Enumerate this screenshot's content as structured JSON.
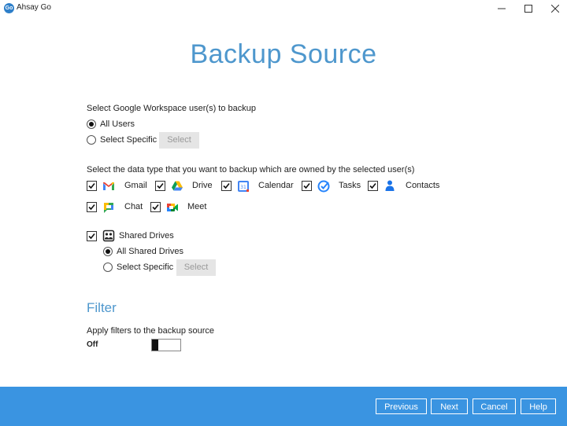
{
  "window": {
    "logo_text": "Go",
    "title": "Ahsay Go"
  },
  "page": {
    "title": "Backup Source"
  },
  "users": {
    "prompt": "Select Google Workspace user(s) to backup",
    "all_users_label": "All Users",
    "all_users_selected": true,
    "select_specific_label": "Select Specific",
    "select_specific_selected": false,
    "select_button": "Select"
  },
  "data_types": {
    "prompt": "Select the data type that you want to backup which are owned by the selected user(s)",
    "items": [
      {
        "label": "Gmail",
        "icon": "gmail-icon",
        "checked": true
      },
      {
        "label": "Drive",
        "icon": "google-drive-icon",
        "checked": true
      },
      {
        "label": "Calendar",
        "icon": "google-calendar-icon",
        "checked": true
      },
      {
        "label": "Tasks",
        "icon": "google-tasks-icon",
        "checked": true
      },
      {
        "label": "Contacts",
        "icon": "google-contacts-icon",
        "checked": true
      },
      {
        "label": "Chat",
        "icon": "google-chat-icon",
        "checked": true
      },
      {
        "label": "Meet",
        "icon": "google-meet-icon",
        "checked": true
      }
    ]
  },
  "shared_drives": {
    "label": "Shared Drives",
    "icon": "shared-drives-icon",
    "checked": true,
    "all_label": "All Shared Drives",
    "all_selected": true,
    "specific_label": "Select Specific",
    "specific_selected": false,
    "select_button": "Select"
  },
  "filter": {
    "heading": "Filter",
    "description": "Apply filters to the backup source",
    "state_label": "Off",
    "enabled": false
  },
  "footer": {
    "previous": "Previous",
    "next": "Next",
    "cancel": "Cancel",
    "help": "Help"
  },
  "colors": {
    "accent": "#4e97cd",
    "footer": "#3a94e1"
  }
}
